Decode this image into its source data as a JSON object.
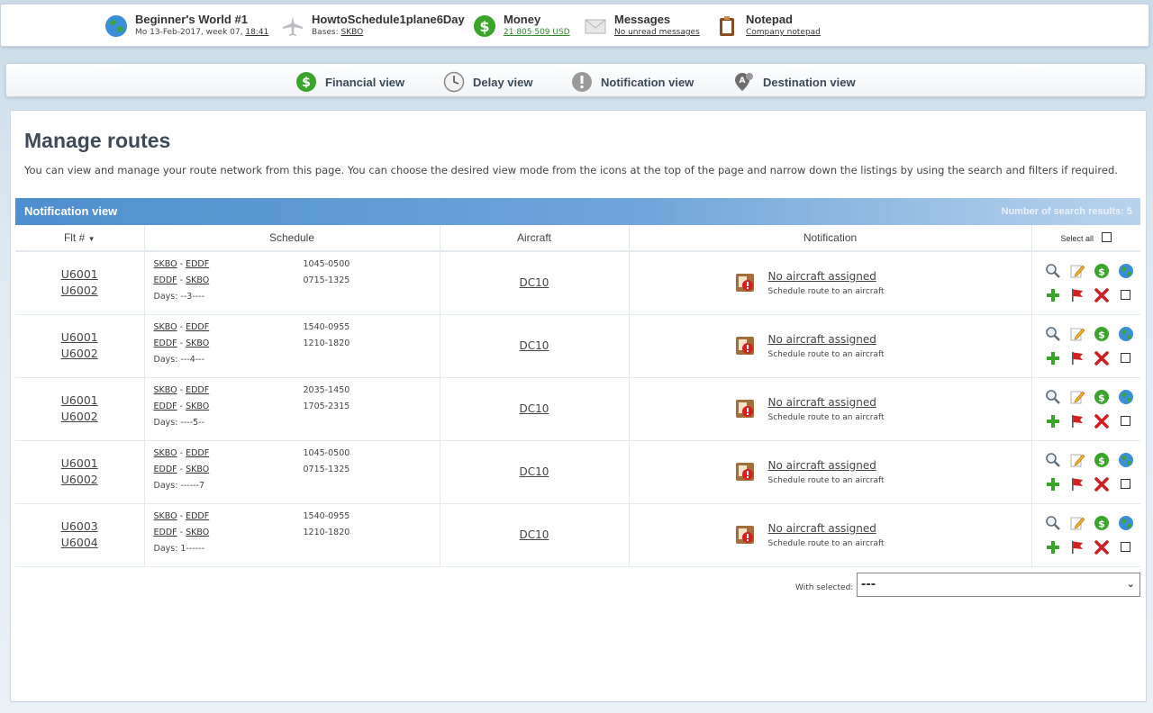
{
  "topbar": {
    "world": {
      "title": "Beginner's World #1",
      "date": "Mo 13-Feb-2017, week 07,",
      "time": "18:41"
    },
    "airline": {
      "title": "HowtoSchedule1plane6Day",
      "bases_label": "Bases:",
      "base": "SKBO"
    },
    "money": {
      "title": "Money",
      "value": "21 805 509 USD"
    },
    "messages": {
      "title": "Messages",
      "sub": "No unread messages"
    },
    "notepad": {
      "title": "Notepad",
      "sub": "Company notepad"
    }
  },
  "views": [
    {
      "label": "Financial view"
    },
    {
      "label": "Delay view"
    },
    {
      "label": "Notification view"
    },
    {
      "label": "Destination view"
    }
  ],
  "page": {
    "title": "Manage routes",
    "intro": "You can view and manage your route network from this page. You can choose the desired view mode from the icons at the top of the page and narrow down the listings by using the search and filters if required."
  },
  "viewbar": {
    "title": "Notification view",
    "count": "Number of search results: 5"
  },
  "table": {
    "headers": {
      "flt": "Flt #",
      "schedule": "Schedule",
      "aircraft": "Aircraft",
      "notification": "Notification",
      "select_all": "Select all"
    },
    "rows": [
      {
        "flt1": "U6001",
        "flt2": "U6002",
        "leg1_from": "SKBO",
        "leg1_to": "EDDF",
        "leg2_from": "EDDF",
        "leg2_to": "SKBO",
        "time1": "1045-0500",
        "time2": "0715-1325",
        "days": "Days: --3----",
        "aircraft": "DC10",
        "notif": "No aircraft assigned",
        "notif_sub": "Schedule route to an aircraft"
      },
      {
        "flt1": "U6001",
        "flt2": "U6002",
        "leg1_from": "SKBO",
        "leg1_to": "EDDF",
        "leg2_from": "EDDF",
        "leg2_to": "SKBO",
        "time1": "1540-0955",
        "time2": "1210-1820",
        "days": "Days: ---4---",
        "aircraft": "DC10",
        "notif": "No aircraft assigned",
        "notif_sub": "Schedule route to an aircraft"
      },
      {
        "flt1": "U6001",
        "flt2": "U6002",
        "leg1_from": "SKBO",
        "leg1_to": "EDDF",
        "leg2_from": "EDDF",
        "leg2_to": "SKBO",
        "time1": "2035-1450",
        "time2": "1705-2315",
        "days": "Days: ----5--",
        "aircraft": "DC10",
        "notif": "No aircraft assigned",
        "notif_sub": "Schedule route to an aircraft"
      },
      {
        "flt1": "U6001",
        "flt2": "U6002",
        "leg1_from": "SKBO",
        "leg1_to": "EDDF",
        "leg2_from": "EDDF",
        "leg2_to": "SKBO",
        "time1": "1045-0500",
        "time2": "0715-1325",
        "days": "Days: ------7",
        "aircraft": "DC10",
        "notif": "No aircraft assigned",
        "notif_sub": "Schedule route to an aircraft"
      },
      {
        "flt1": "U6003",
        "flt2": "U6004",
        "leg1_from": "SKBO",
        "leg1_to": "EDDF",
        "leg2_from": "EDDF",
        "leg2_to": "SKBO",
        "time1": "1540-0955",
        "time2": "1210-1820",
        "days": "Days: 1------",
        "aircraft": "DC10",
        "notif": "No aircraft assigned",
        "notif_sub": "Schedule route to an aircraft"
      }
    ]
  },
  "footer": {
    "with_selected": "With selected:",
    "select_value": "---"
  },
  "icons": {
    "world": "globe-icon",
    "airline": "airplane-icon",
    "money": "dollar-icon",
    "messages": "envelope-icon",
    "notepad": "clipboard-icon",
    "row_actions": [
      "magnifier-icon",
      "edit-note-icon",
      "dollar-icon",
      "globe-icon",
      "plus-icon",
      "flag-icon",
      "delete-x-icon"
    ]
  },
  "colors": {
    "accent": "#4f8fcf",
    "money_green": "#2a8a2a",
    "delete_red": "#cc2020",
    "add_green": "#3aa52a"
  }
}
